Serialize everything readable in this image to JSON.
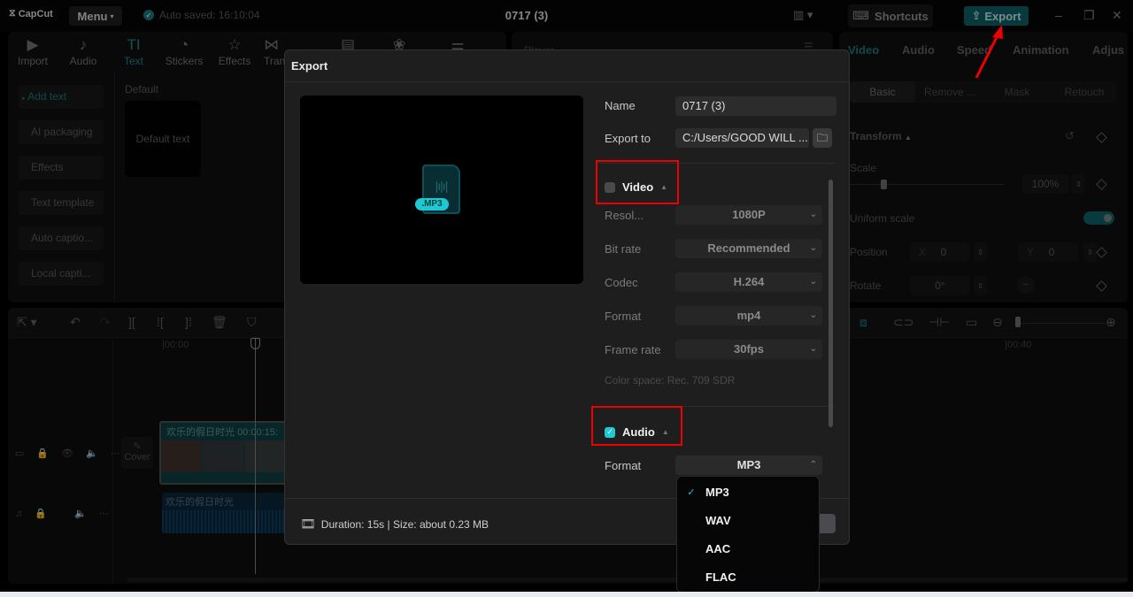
{
  "app": {
    "logo": "CapCut",
    "menu_label": "Menu",
    "autosave": "Auto saved: 16:10:04",
    "project_title": "0717 (3)",
    "shortcuts_label": "Shortcuts",
    "export_label": "Export"
  },
  "toolbar": {
    "items": [
      {
        "label": "Import",
        "icon": "import-icon"
      },
      {
        "label": "Audio",
        "icon": "audio-icon"
      },
      {
        "label": "Text",
        "icon": "text-icon",
        "active": true
      },
      {
        "label": "Stickers",
        "icon": "stickers-icon"
      },
      {
        "label": "Effects",
        "icon": "effects-icon"
      },
      {
        "label": "Tran",
        "icon": "transitions-icon"
      }
    ]
  },
  "text_panel": {
    "side_items": [
      "Add text",
      "AI packaging",
      "Effects",
      "Text template",
      "Auto captio...",
      "Local capti..."
    ],
    "section_label": "Default",
    "card_label": "Default text"
  },
  "player": {
    "label": "Player"
  },
  "right_panel": {
    "tabs": [
      "Video",
      "Audio",
      "Speed",
      "Animation",
      "Adjus"
    ],
    "subtabs": [
      "Basic",
      "Remove ...",
      "Mask",
      "Retouch"
    ],
    "transform_label": "Transform",
    "scale_label": "Scale",
    "scale_value": "100%",
    "scale_fraction": 0.2,
    "uniform_scale_label": "Uniform scale",
    "uniform_scale_on": true,
    "position_label": "Position",
    "pos_x_label": "X",
    "pos_x": "0",
    "pos_y_label": "Y",
    "pos_y": "0",
    "rotate_label": "Rotate",
    "rotate_value": "0°"
  },
  "timeline": {
    "tick_start": "00:00",
    "tick_end": "00:40",
    "cover_label": "Cover",
    "video_clip_title": "欢乐的假日时光",
    "video_clip_duration": "00:00:15:",
    "audio_clip_title": "欢乐的假日时光"
  },
  "export_dialog": {
    "title": "Export",
    "preview_badge": ".MP3",
    "name_label": "Name",
    "name_value": "0717 (3)",
    "export_to_label": "Export to",
    "export_to_value": "C:/Users/GOOD WILL ...",
    "video_section": {
      "label": "Video",
      "checked": false,
      "resolution_label": "Resol...",
      "resolution_value": "1080P",
      "bitrate_label": "Bit rate",
      "bitrate_value": "Recommended",
      "codec_label": "Codec",
      "codec_value": "H.264",
      "format_label": "Format",
      "format_value": "mp4",
      "framerate_label": "Frame rate",
      "framerate_value": "30fps",
      "color_space": "Color space: Rec. 709 SDR"
    },
    "audio_section": {
      "label": "Audio",
      "checked": true,
      "format_label": "Format",
      "format_value": "MP3"
    },
    "footer_info": "Duration: 15s | Size: about 0.23 MB"
  },
  "format_dropdown": {
    "options": [
      "MP3",
      "WAV",
      "AAC",
      "FLAC"
    ],
    "selected": "MP3"
  },
  "colors": {
    "accent": "#1ec8d4",
    "annotation_red": "#e00000"
  }
}
